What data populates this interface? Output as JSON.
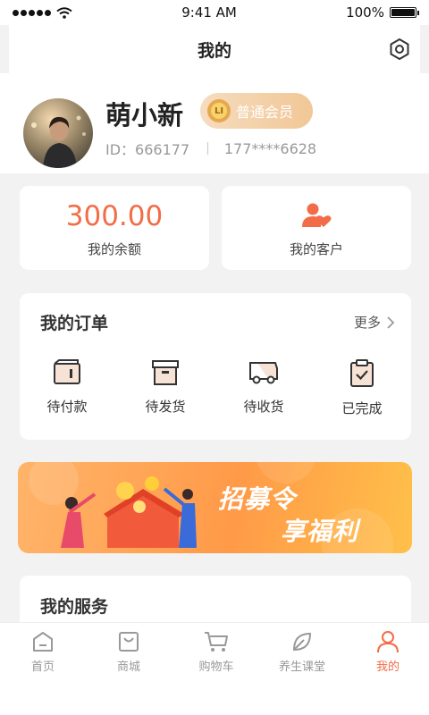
{
  "status_bar": {
    "time": "9:41 AM",
    "battery": "100%",
    "battery_level": 1.0
  },
  "header": {
    "title": "我的",
    "settings_icon": "settings-icon"
  },
  "profile": {
    "name": "萌小新",
    "member_level": "普通会员",
    "member_badge_text": "LI",
    "id_text": "ID：666177",
    "phone": "177****6628"
  },
  "stats": {
    "balance_value": "300.00",
    "balance_label": "我的余额",
    "customers_label": "我的客户",
    "customers_icon": "customers-icon"
  },
  "orders": {
    "title": "我的订单",
    "more_label": "更多",
    "items": [
      {
        "label": "待付款",
        "icon": "wallet-icon"
      },
      {
        "label": "待发货",
        "icon": "box-icon"
      },
      {
        "label": "待收货",
        "icon": "truck-icon"
      },
      {
        "label": "已完成",
        "icon": "clipboard-check-icon"
      }
    ]
  },
  "banner": {
    "line1": "招募令",
    "line2": "享福利"
  },
  "services": {
    "title": "我的服务"
  },
  "tabs": [
    {
      "label": "首页",
      "icon": "home-icon",
      "active": false
    },
    {
      "label": "商城",
      "icon": "shopping-bag-icon",
      "active": false
    },
    {
      "label": "购物车",
      "icon": "cart-icon",
      "active": false
    },
    {
      "label": "养生课堂",
      "icon": "leaf-icon",
      "active": false
    },
    {
      "label": "我的",
      "icon": "person-icon",
      "active": true
    }
  ],
  "colors": {
    "accent": "#f26d47",
    "gold": "#f1c796",
    "banner": "#ff9a48"
  }
}
